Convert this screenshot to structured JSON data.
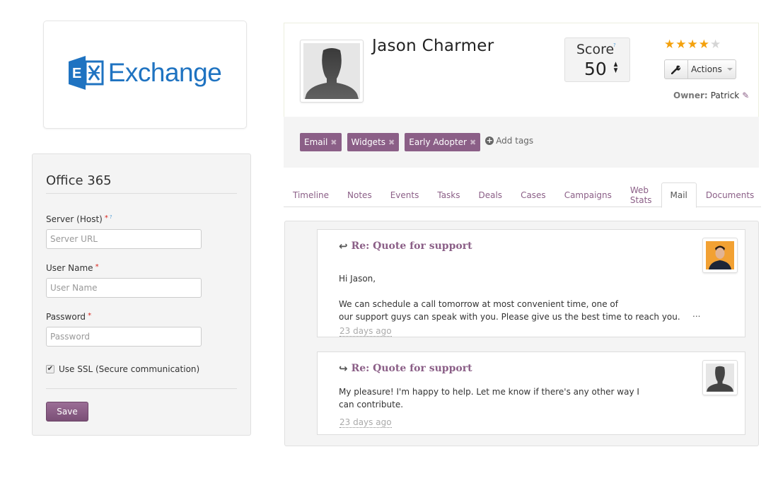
{
  "logo": {
    "text": "Exchange",
    "icon": "exchange-logo-icon",
    "color": "#1f73c1"
  },
  "office365": {
    "title": "Office 365",
    "fields": [
      {
        "label": "Server (Host)",
        "required_mark": "*",
        "help_mark": "?",
        "placeholder": "Server URL",
        "value": ""
      },
      {
        "label": "User Name",
        "required_mark": "*",
        "placeholder": "User Name",
        "value": ""
      },
      {
        "label": "Password",
        "required_mark": "*",
        "placeholder": "Password",
        "value": ""
      }
    ],
    "ssl": {
      "label": "Use SSL (Secure communication)",
      "checked": true,
      "check_glyph": "✔"
    },
    "save_label": "Save"
  },
  "contact": {
    "name": "Jason Charmer",
    "score": {
      "label": "Score",
      "help_mark": "?",
      "value": "50",
      "up": "▲",
      "down": "▼"
    },
    "rating": {
      "value": 4,
      "max": 5,
      "star_glyph": "★"
    },
    "actions_label": "Actions",
    "wrench_icon": "wrench-icon",
    "owner": {
      "label": "Owner:",
      "value": "Patrick",
      "edit_glyph": "✎"
    },
    "tags": [
      {
        "label": "Email",
        "remove": "✖"
      },
      {
        "label": "Widgets",
        "remove": "✖"
      },
      {
        "label": "Early Adopter",
        "remove": "✖"
      }
    ],
    "add_tags": {
      "icon": "+",
      "label": "Add tags"
    }
  },
  "tabs": [
    {
      "label": "Timeline",
      "active": false
    },
    {
      "label": "Notes",
      "active": false
    },
    {
      "label": "Events",
      "active": false
    },
    {
      "label": "Tasks",
      "active": false
    },
    {
      "label": "Deals",
      "active": false
    },
    {
      "label": "Cases",
      "active": false
    },
    {
      "label": "Campaigns",
      "active": false
    },
    {
      "label": "Web Stats",
      "active": false
    },
    {
      "label": "Mail",
      "active": true
    },
    {
      "label": "Documents",
      "active": false
    }
  ],
  "mail": [
    {
      "direction": "incoming",
      "direction_glyph": "↩",
      "subject": "Re: Quote for support",
      "lines": [
        "Hi Jason,",
        "",
        "We can schedule a call tomorrow at most convenient time, one of",
        "our support guys can speak with you. Please give us the best time to reach you."
      ],
      "more": "...",
      "time": "23 days ago",
      "avatar": "photo"
    },
    {
      "direction": "outgoing",
      "direction_glyph": "↪",
      "subject": "Re: Quote for support",
      "lines": [
        "My pleasure! I'm happy to help. Let me know if there's any other way I",
        "can contribute."
      ],
      "time": "23 days ago",
      "avatar": "placeholder"
    }
  ],
  "colors": {
    "accent": "#8b5f87",
    "star": "#f4a10c",
    "required": "#d9251d",
    "help": "#5aa2d6"
  }
}
